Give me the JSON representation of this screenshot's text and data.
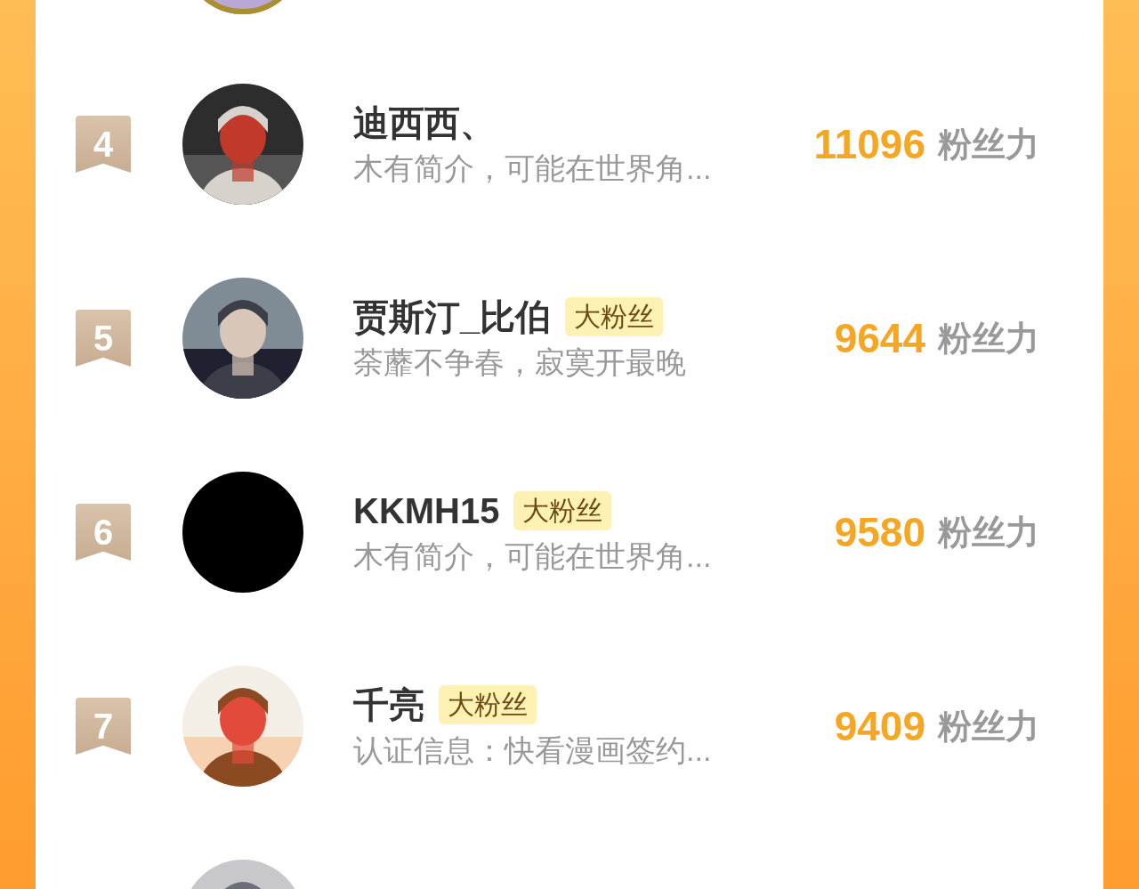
{
  "top_cut": {
    "ring": true
  },
  "rows": [
    {
      "rank": "4",
      "name": "迪西西、",
      "badge": null,
      "bio": "木有简介，可能在世界角...",
      "score": "11096",
      "score_label": "粉丝力"
    },
    {
      "rank": "5",
      "name": "贾斯汀_比伯",
      "badge": "大粉丝",
      "bio": "荼蘼不争春，寂寞开最晚",
      "score": "9644",
      "score_label": "粉丝力"
    },
    {
      "rank": "6",
      "name": "KKMH15",
      "badge": "大粉丝",
      "bio": "木有简介，可能在世界角...",
      "score": "9580",
      "score_label": "粉丝力",
      "avatar": {
        "kind": "blank"
      }
    },
    {
      "rank": "7",
      "name": "千亮",
      "badge": "大粉丝",
      "bio": "认证信息：快看漫画签约...",
      "score": "9409",
      "score_label": "粉丝力"
    }
  ]
}
